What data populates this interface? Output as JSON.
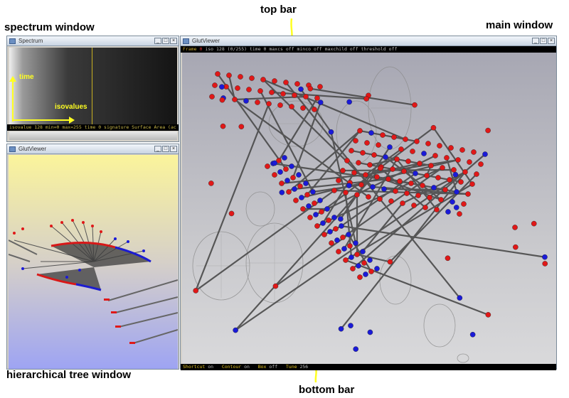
{
  "callouts": {
    "spectrum": "spectrum window",
    "top_bar": "top bar",
    "main": "main window",
    "tree": "hierarchical tree window",
    "bottom_bar": "bottom bar"
  },
  "spectrum_window": {
    "title": "Spectrum",
    "time_label": "time",
    "isovalues_label": "isovalues",
    "status": "isovalue 128 min=0 max=255 time 0 signature Surface Area (ac"
  },
  "tree_window": {
    "title": "GlutViewer"
  },
  "main_window": {
    "title": "GlutViewer",
    "top_bar": {
      "frame_label": "Frame",
      "frame_value": "0",
      "rest": "iso 128 (0/255) time 0 maxcs off minco off maxchild off threshold off"
    },
    "bottom_bar": {
      "shortcut_label": "Shortcut",
      "shortcut_value": "on",
      "contour_label": "Contour",
      "contour_value": "on",
      "box_label": "Box",
      "box_value": "off",
      "tune_label": "Tune",
      "tune_value": "256"
    }
  },
  "window_buttons": {
    "minimize": "_",
    "maximize": "□",
    "close": "×"
  },
  "colors": {
    "accent_arrow": "#ffff22",
    "node_red": "#e01818",
    "node_blue": "#1a1ad8",
    "main_bg_top": "#a9a9b5",
    "main_bg_bottom": "#d6d6d8",
    "tree_bg_top": "#faf29a",
    "tree_bg_bottom": "#9aa1f2"
  },
  "icons": [
    "app-icon",
    "minimize-icon",
    "maximize-icon",
    "close-icon",
    "down-arrow-icon"
  ]
}
